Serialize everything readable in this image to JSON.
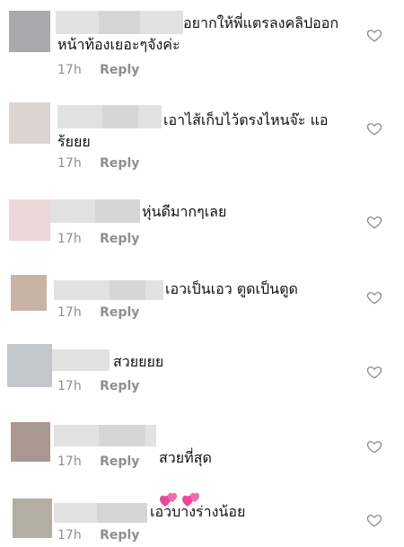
{
  "comments": [
    {
      "text": "อยากให้พี่แตรลงคลิปออก\nหน้าท้องเยอะๆจังค่ะ",
      "time": "17h",
      "reply": "Reply",
      "avatar_color": "#a8a8ad"
    },
    {
      "text": "เอาไส้เก็บไว้ตรงไหนจ๊ะ แอ\nร้ยยย",
      "time": "17h",
      "reply": "Reply",
      "avatar_color": "#ddd4d1"
    },
    {
      "text": "หุ่นดีมากๆเลย",
      "time": "17h",
      "reply": "Reply",
      "avatar_color": "#ecd6d9"
    },
    {
      "text": "เอวเป็นเอว ตูดเป็นตูด",
      "time": "17h",
      "reply": "Reply",
      "avatar_color": "#c9b2a6"
    },
    {
      "text": "สวยยยย",
      "time": "17h",
      "reply": "Reply",
      "avatar_color": "#c3c6cb"
    },
    {
      "text": "สวยที่สุด",
      "emoji": "two-hearts",
      "time": "17h",
      "reply": "Reply",
      "avatar_color": "#a99792"
    },
    {
      "text": "เอวบางร่างน้อย",
      "time": "17h",
      "reply": "Reply",
      "avatar_color": "#b4ada3"
    }
  ],
  "colors": {
    "meta_text": "#8e8e8e",
    "emoji_heart": "#e8479b"
  }
}
